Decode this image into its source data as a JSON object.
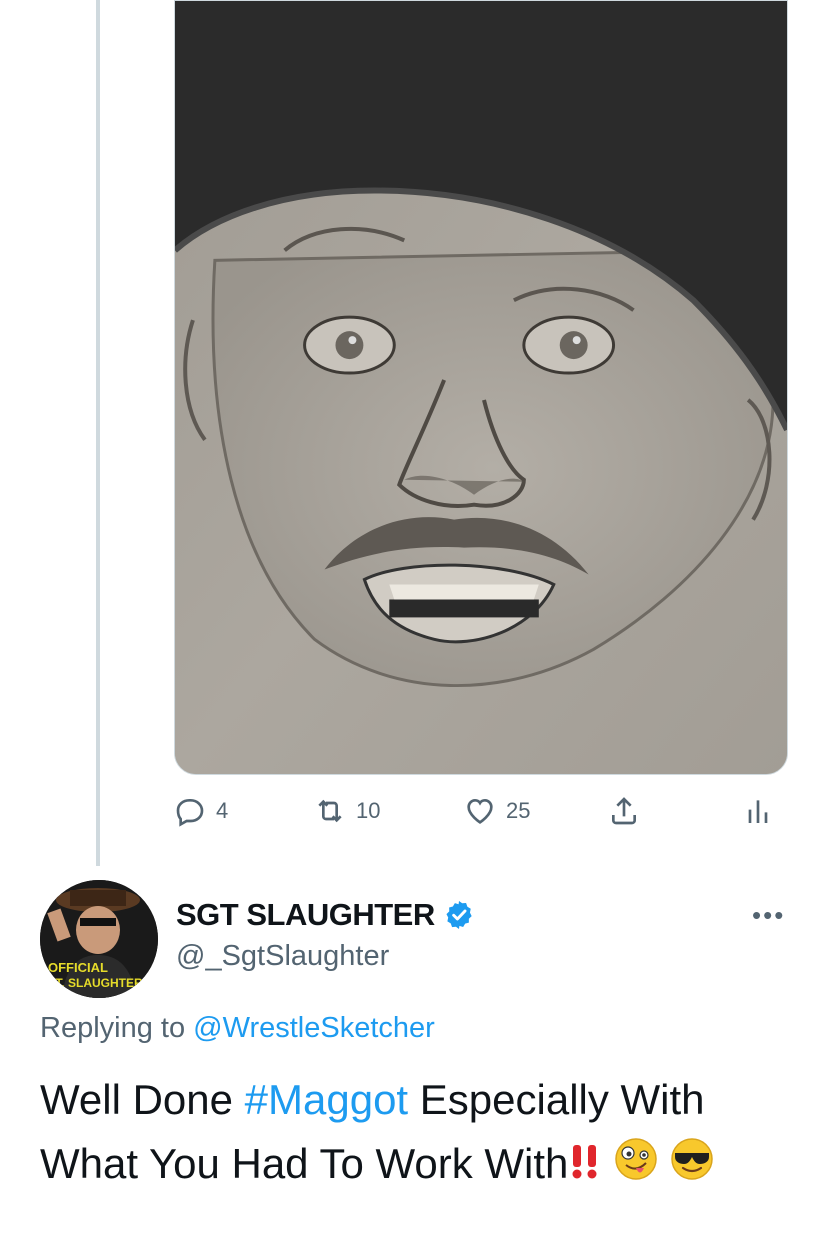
{
  "tweet_media": {
    "alt": "pencil sketch portrait"
  },
  "actions": {
    "reply_count": "4",
    "retweet_count": "10",
    "like_count": "25",
    "icons": [
      "reply-icon",
      "retweet-icon",
      "like-icon",
      "share-icon",
      "analytics-icon"
    ]
  },
  "reply": {
    "avatar_text_line1": "OFFICIAL",
    "avatar_text_line2": "SGT. SLAUGHTER",
    "display_name": "SGT SLAUGHTER",
    "handle": "@_SgtSlaughter",
    "more": "•••",
    "replying_label": "Replying to",
    "replying_mention": "@WrestleSketcher",
    "text_part1": "Well Done ",
    "hashtag": "#Maggot",
    "text_part2": " Especially With What You Had To Work With",
    "emojis": [
      "double-exclamation",
      "zany-face",
      "sunglasses-face"
    ]
  },
  "colors": {
    "accent": "#1d9bf0",
    "muted": "#536471",
    "text": "#0f1419",
    "divider": "#cfd9de"
  }
}
